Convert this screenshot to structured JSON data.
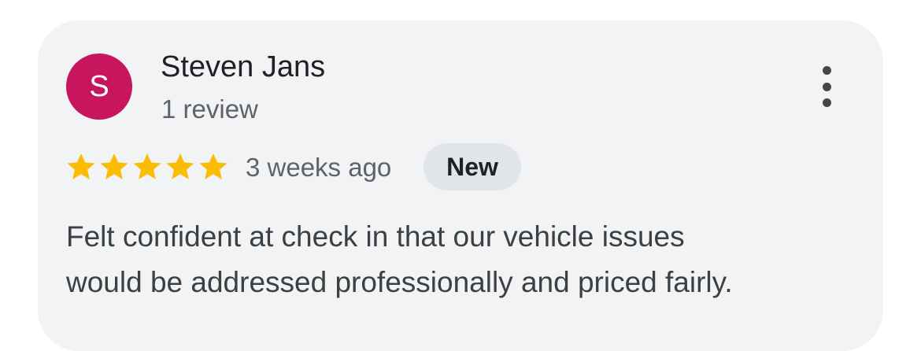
{
  "review": {
    "author": {
      "name": "Steven Jans",
      "avatar_initial": "S",
      "avatar_color": "#c8165e",
      "review_count": "1 review"
    },
    "rating": 5,
    "rating_max": 5,
    "star_color": "#fbbc04",
    "time_ago": "3 weeks ago",
    "badge": "New",
    "text_lines": [
      "Felt confident at check in that our vehicle issues",
      "would be addressed professionally and priced fairly."
    ]
  },
  "icons": {
    "more": "more-vert-icon",
    "star": "star-icon"
  },
  "colors": {
    "card_background": "#f1f3f5",
    "badge_background": "#e1e4e8"
  }
}
